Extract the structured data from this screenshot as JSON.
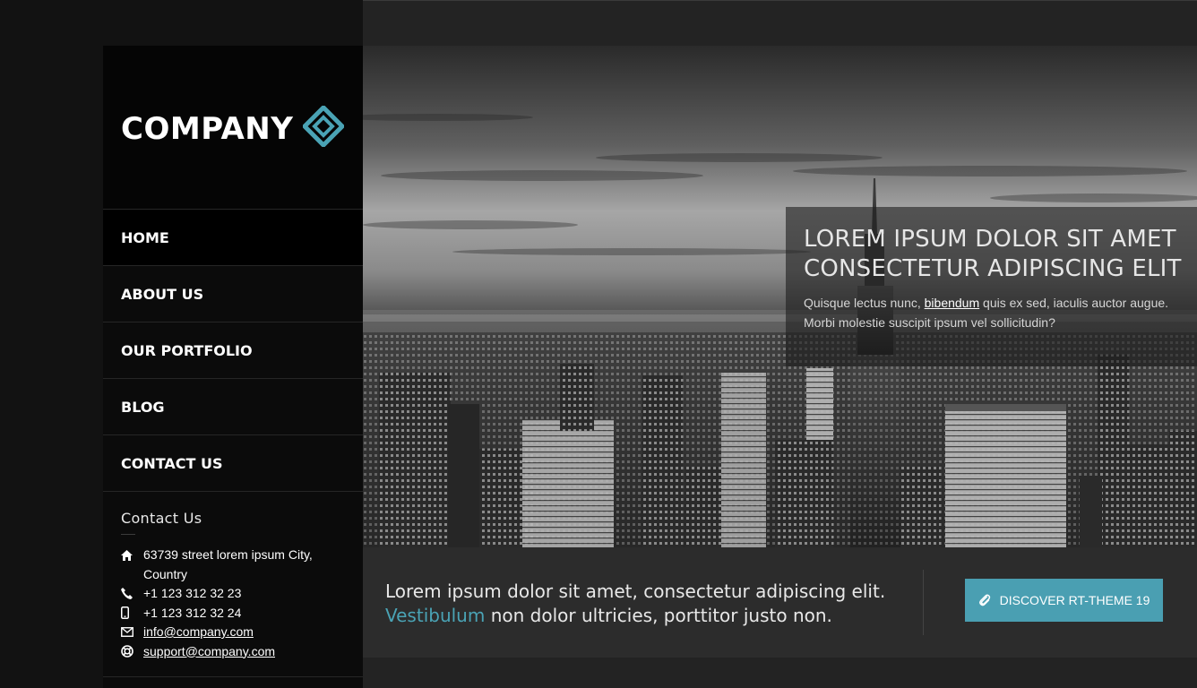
{
  "brand": {
    "name": "COMPANY",
    "accent_color": "#4aa3b5"
  },
  "nav": {
    "items": [
      {
        "label": "HOME",
        "active": true
      },
      {
        "label": "ABOUT US"
      },
      {
        "label": "OUR PORTFOLIO"
      },
      {
        "label": "BLOG"
      },
      {
        "label": "CONTACT US"
      }
    ]
  },
  "contact": {
    "title": "Contact Us",
    "address_line1": "63739 street lorem ipsum City,",
    "address_line2": "Country",
    "phone": "+1 123 312 32 23",
    "mobile": "+1 123 312 32 24",
    "email": "info@company.com",
    "support": "support@company.com",
    "icons": [
      "home-icon",
      "phone-icon",
      "mobile-icon",
      "envelope-icon",
      "lifebuoy-icon"
    ]
  },
  "hero": {
    "heading_line1": "LOREM IPSUM DOLOR SIT AMET",
    "heading_line2": "CONSECTETUR ADIPISCING ELIT",
    "text_before": "Quisque lectus nunc, ",
    "link": "bibendum",
    "text_after": " quis ex sed, iaculis auctor augue. Morbi molestie suscipit ipsum vel sollicitudin?"
  },
  "cta": {
    "line1": "Lorem ipsum dolor sit amet, consectetur adipiscing elit.",
    "accent_word": "Vestibulum",
    "line2_rest": " non dolor ultricies, porttitor justo non.",
    "button_label": "DISCOVER RT-THEME 19",
    "button_icon": "paperclip-icon",
    "button_color": "#4a9fb2"
  }
}
